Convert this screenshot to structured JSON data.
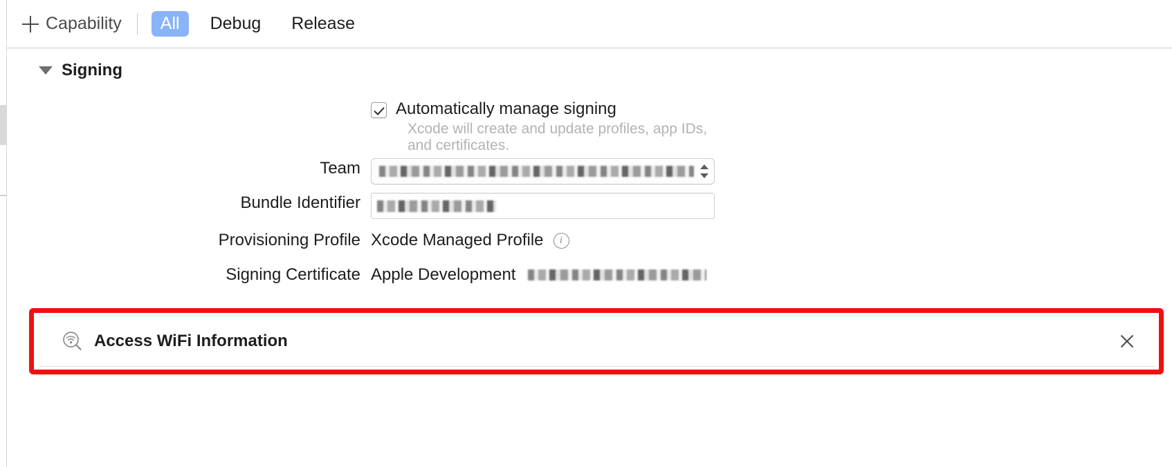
{
  "toolbar": {
    "add_capability_label": "Capability",
    "add_icon": "plus-icon",
    "filters": [
      {
        "label": "All",
        "active": true
      },
      {
        "label": "Debug",
        "active": false
      },
      {
        "label": "Release",
        "active": false
      }
    ]
  },
  "section": {
    "title": "Signing",
    "expanded": true,
    "disclosure_icon": "triangle-down-icon"
  },
  "signing": {
    "auto_manage": {
      "label": "Automatically manage signing",
      "checked": true,
      "help_text": "Xcode will create and update profiles, app IDs, and certificates."
    },
    "rows": [
      {
        "label": "Team",
        "control": "popup-button",
        "value": "",
        "redacted": true,
        "stepper_icon": "stepper-arrows-icon"
      },
      {
        "label": "Bundle Identifier",
        "control": "text-field",
        "value": "",
        "redacted": true
      },
      {
        "label": "Provisioning Profile",
        "control": "static-text",
        "value": "Xcode Managed Profile",
        "info_icon": "info-circle-icon"
      },
      {
        "label": "Signing Certificate",
        "control": "static-text",
        "value": "Apple Development",
        "suffix_redacted": true
      }
    ]
  },
  "capability": {
    "icon": "wifi-magnifier-icon",
    "title": "Access WiFi Information",
    "close_icon": "close-icon",
    "highlighted": true
  },
  "colors": {
    "accent_selected": "#8ab4f8",
    "annotation": "#f01010",
    "text_primary": "#1d1d1d",
    "text_muted": "#b2b2b2",
    "border": "#cfcfcf"
  }
}
